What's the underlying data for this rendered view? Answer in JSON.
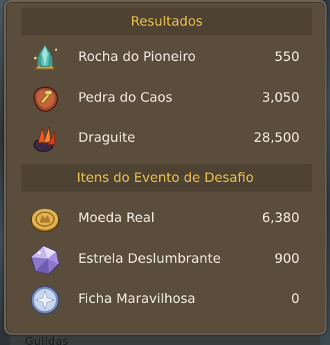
{
  "background_text": "Guildas",
  "results": {
    "title": "Resultados",
    "items": [
      {
        "name": "Rocha do Pioneiro",
        "value": "550",
        "icon": "pioneer-rock-icon"
      },
      {
        "name": "Pedra do Caos",
        "value": "3,050",
        "icon": "chaos-stone-icon"
      },
      {
        "name": "Draguite",
        "value": "28,500",
        "icon": "draguite-icon"
      }
    ]
  },
  "event": {
    "title": "Itens do Evento de Desafio",
    "items": [
      {
        "name": "Moeda Real",
        "value": "6,380",
        "icon": "royal-coin-icon"
      },
      {
        "name": "Estrela Deslumbrante",
        "value": "900",
        "icon": "dazzling-star-icon"
      },
      {
        "name": "Ficha Maravilhosa",
        "value": "0",
        "icon": "marvelous-token-icon"
      }
    ]
  },
  "colors": {
    "panel": "#5b4d3c",
    "header_bg": "#4e4233",
    "header_text": "#e8c04e",
    "item_text": "#f2ece2"
  }
}
